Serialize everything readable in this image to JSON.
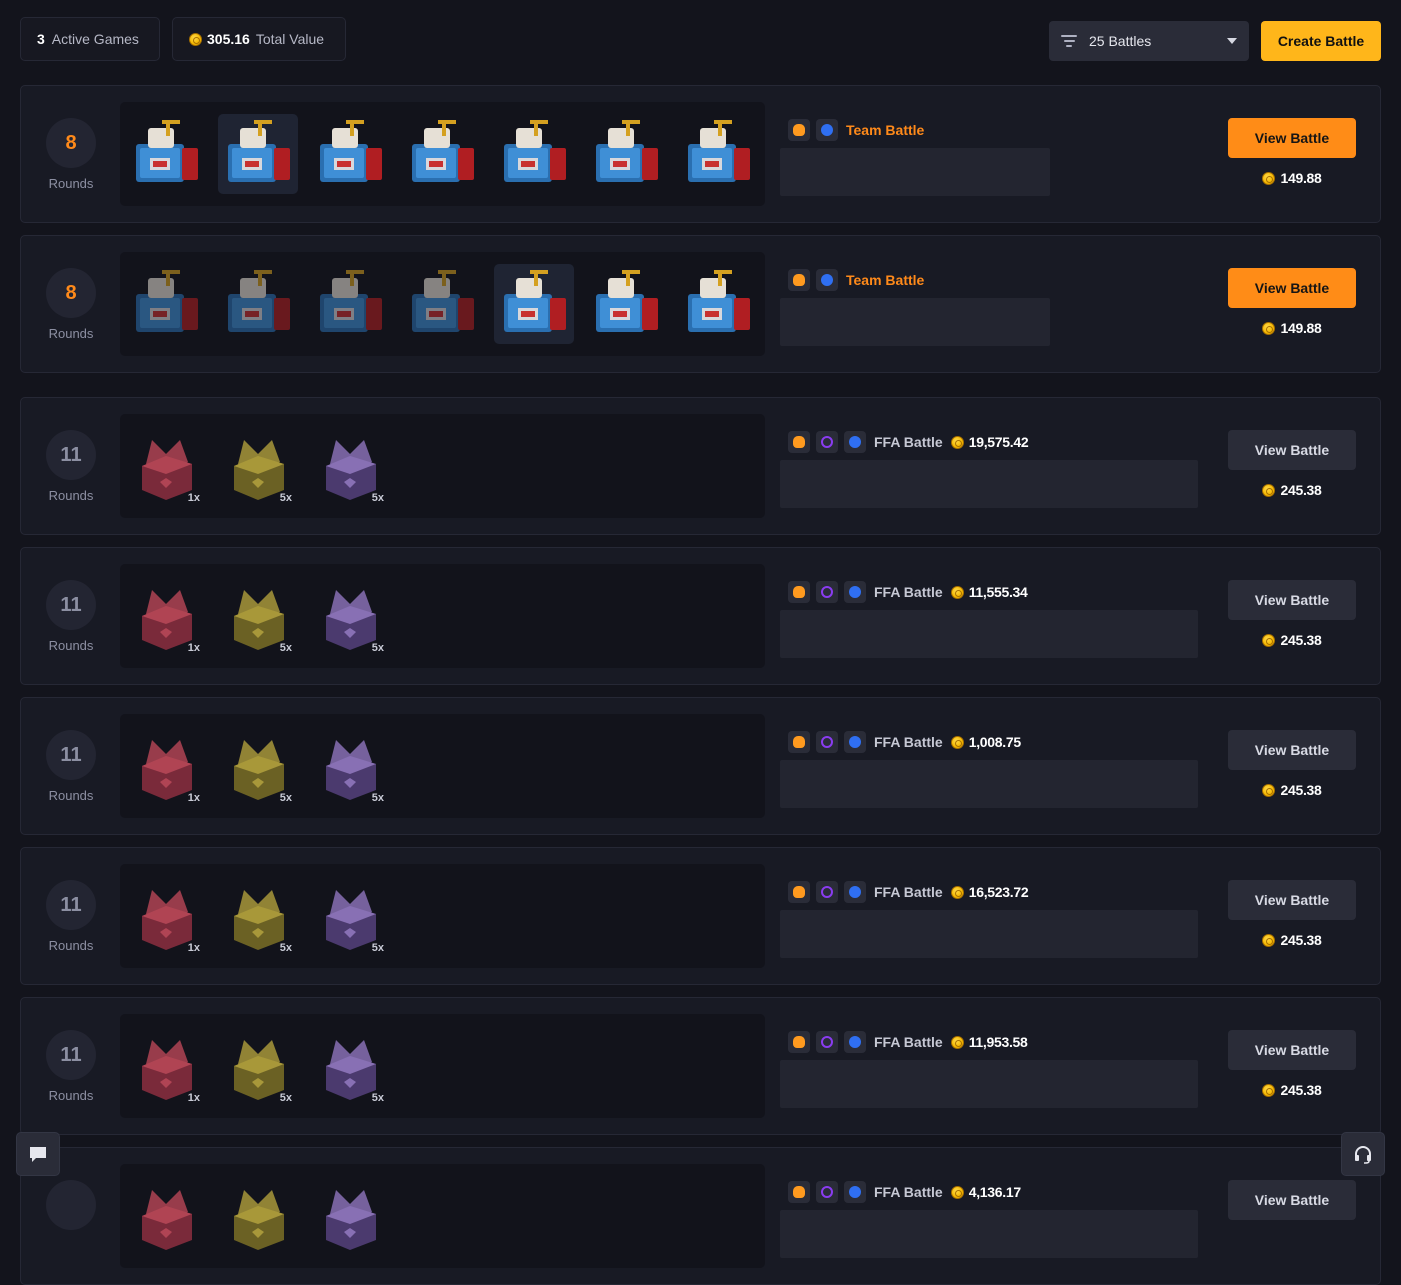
{
  "header": {
    "active_games_count": "3",
    "active_games_label": "Active Games",
    "total_value_amount": "305.16",
    "total_value_label": "Total Value",
    "filter_label": "25 Battles",
    "create_button": "Create Battle"
  },
  "battles": [
    {
      "rounds": "8",
      "rounds_label": "Rounds",
      "mode": "Team Battle",
      "mode_type": "team",
      "pot": "",
      "view_label": "View Battle",
      "view_style": "orange",
      "cost": "149.88",
      "case_kind": "blue",
      "cases": [
        "",
        "",
        "",
        "",
        "",
        "",
        ""
      ],
      "selected_case": 1,
      "dimmed_through": 0,
      "player_box_width": 270,
      "badges": [
        "skull-icon",
        "blue-icon"
      ]
    },
    {
      "rounds": "8",
      "rounds_label": "Rounds",
      "mode": "Team Battle",
      "mode_type": "team",
      "pot": "",
      "view_label": "View Battle",
      "view_style": "orange",
      "cost": "149.88",
      "case_kind": "blue",
      "cases": [
        "",
        "",
        "",
        "",
        "",
        "",
        ""
      ],
      "selected_case": 4,
      "dimmed_through": 4,
      "player_box_width": 270,
      "badges": [
        "skull-icon",
        "blue-icon"
      ]
    },
    {
      "rounds": "11",
      "rounds_label": "Rounds",
      "mode": "FFA Battle",
      "mode_type": "ffa",
      "pot": "19,575.42",
      "view_label": "View Battle",
      "view_style": "grey",
      "cost": "245.38",
      "case_kind": "mixed",
      "cases": [
        "1x",
        "5x",
        "5x"
      ],
      "selected_case": -1,
      "dimmed_through": 0,
      "player_box_width": 418,
      "badges": [
        "skull-icon",
        "purple-icon",
        "blue-icon"
      ]
    },
    {
      "rounds": "11",
      "rounds_label": "Rounds",
      "mode": "FFA Battle",
      "mode_type": "ffa",
      "pot": "11,555.34",
      "view_label": "View Battle",
      "view_style": "grey",
      "cost": "245.38",
      "case_kind": "mixed",
      "cases": [
        "1x",
        "5x",
        "5x"
      ],
      "selected_case": -1,
      "dimmed_through": 0,
      "player_box_width": 418,
      "badges": [
        "skull-icon",
        "purple-icon",
        "blue-icon"
      ]
    },
    {
      "rounds": "11",
      "rounds_label": "Rounds",
      "mode": "FFA Battle",
      "mode_type": "ffa",
      "pot": "1,008.75",
      "view_label": "View Battle",
      "view_style": "grey",
      "cost": "245.38",
      "case_kind": "mixed",
      "cases": [
        "1x",
        "5x",
        "5x"
      ],
      "selected_case": -1,
      "dimmed_through": 0,
      "player_box_width": 418,
      "badges": [
        "skull-icon",
        "purple-icon",
        "blue-icon"
      ]
    },
    {
      "rounds": "11",
      "rounds_label": "Rounds",
      "mode": "FFA Battle",
      "mode_type": "ffa",
      "pot": "16,523.72",
      "view_label": "View Battle",
      "view_style": "grey",
      "cost": "245.38",
      "case_kind": "mixed",
      "cases": [
        "1x",
        "5x",
        "5x"
      ],
      "selected_case": -1,
      "dimmed_through": 0,
      "player_box_width": 418,
      "badges": [
        "skull-icon",
        "purple-icon",
        "blue-icon"
      ]
    },
    {
      "rounds": "11",
      "rounds_label": "Rounds",
      "mode": "FFA Battle",
      "mode_type": "ffa",
      "pot": "11,953.58",
      "view_label": "View Battle",
      "view_style": "grey",
      "cost": "245.38",
      "case_kind": "mixed",
      "cases": [
        "1x",
        "5x",
        "5x"
      ],
      "selected_case": -1,
      "dimmed_through": 0,
      "player_box_width": 418,
      "badges": [
        "skull-icon",
        "purple-icon",
        "blue-icon"
      ]
    },
    {
      "rounds": "",
      "rounds_label": "",
      "mode": "FFA Battle",
      "mode_type": "ffa",
      "pot": "4,136.17",
      "view_label": "View Battle",
      "view_style": "grey",
      "cost": "",
      "case_kind": "mixed",
      "cases": [
        "",
        "",
        ""
      ],
      "selected_case": -1,
      "dimmed_through": 0,
      "player_box_width": 418,
      "badges": [
        "skull-icon",
        "purple-icon",
        "blue-icon"
      ]
    }
  ],
  "colors": {
    "accent_yellow": "#ffb61a",
    "accent_orange": "#ff8c17",
    "background": "#13141c",
    "card": "#181a24"
  },
  "floating": {
    "chat_icon": "chat-bubble-icon",
    "support_icon": "headset-icon"
  }
}
